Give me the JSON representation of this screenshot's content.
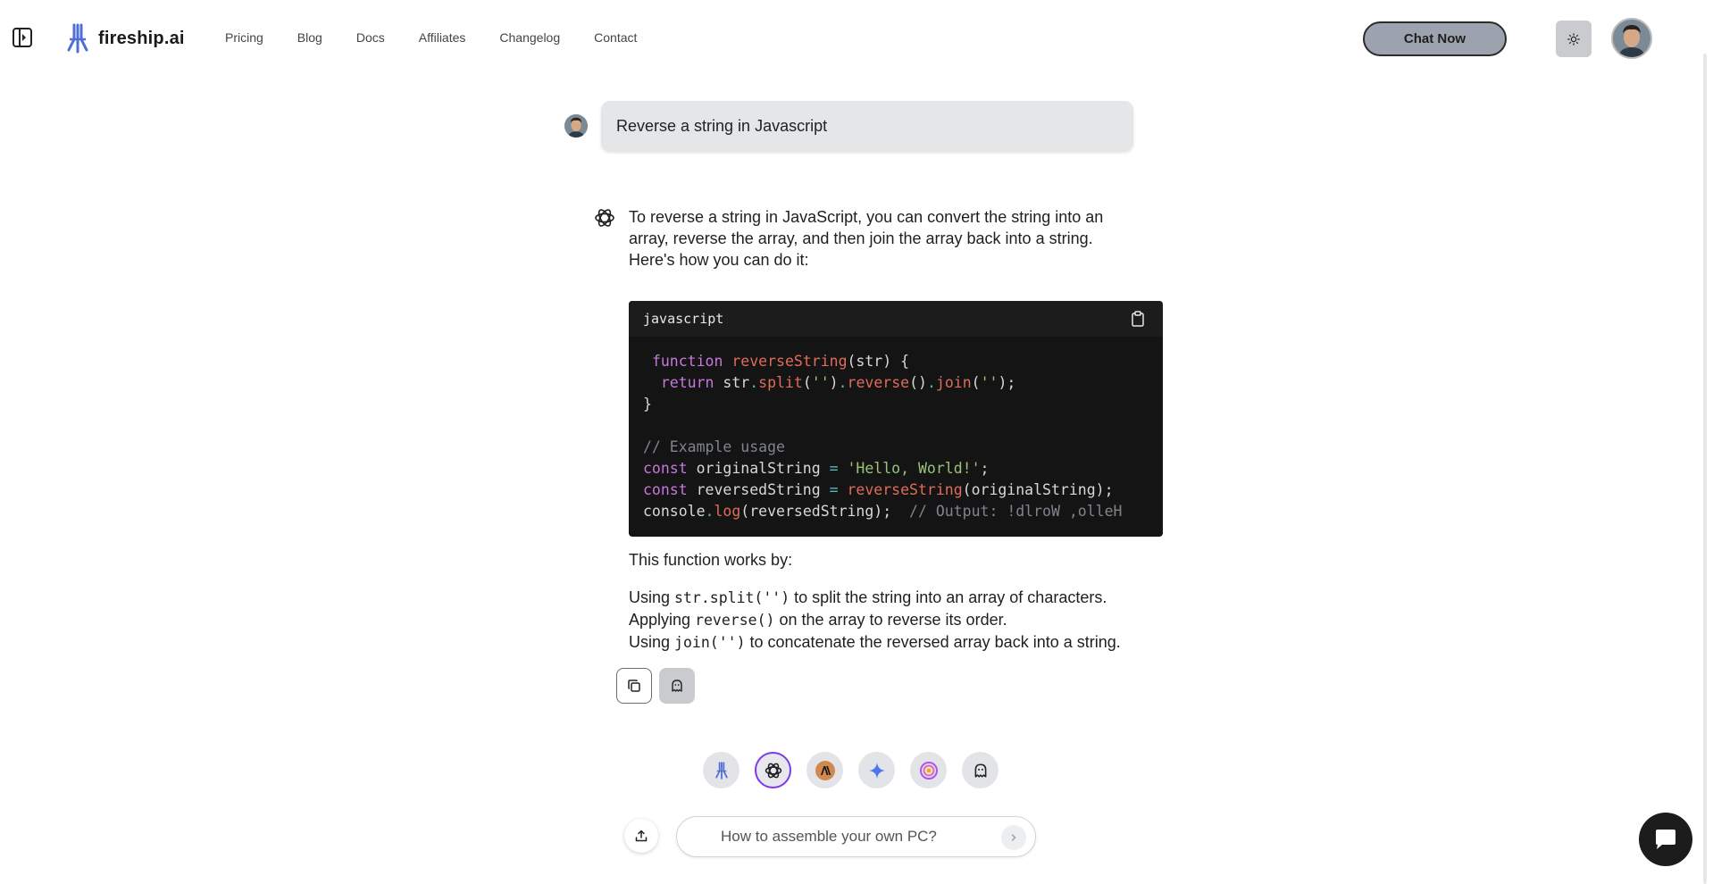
{
  "header": {
    "brand": "fireship.ai",
    "nav": [
      "Pricing",
      "Blog",
      "Docs",
      "Affiliates",
      "Changelog",
      "Contact"
    ],
    "chat_now_label": "Chat Now",
    "icons": {
      "sidebar": "sidebar-toggle-icon",
      "logo": "fireship-logo-icon",
      "theme": "sun-icon"
    }
  },
  "conversation": {
    "user_message": "Reverse a string in Javascript",
    "assistant_intro": "To reverse a string in JavaScript, you can convert the string into an array, reverse the array, and then join the array back into a string. Here's how you can do it:",
    "code": {
      "language": "javascript",
      "lines": [
        " function reverseString(str) {",
        "  return str.split('').reverse().join('');",
        "}",
        "",
        "// Example usage",
        "const originalString = 'Hello, World!';",
        "const reversedString = reverseString(originalString);",
        "console.log(reversedString);  // Output: !dlroW ,olleH"
      ]
    },
    "works_by": "This function works by:",
    "steps": [
      {
        "before": "Using ",
        "code": "str.split('')",
        "after": " to split the string into an array of characters."
      },
      {
        "before": "Applying ",
        "code": "reverse()",
        "after": " on the array to reverse its order."
      },
      {
        "before": "Using ",
        "code": "join('')",
        "after": " to concatenate the reversed array back into a string."
      }
    ]
  },
  "models": [
    "fireship",
    "openai",
    "anthropic",
    "gemini",
    "llama",
    "ghost"
  ],
  "active_model": "openai",
  "input": {
    "placeholder": "How to assemble your own PC?",
    "value": ""
  },
  "colors": {
    "accent": "#7c3aed",
    "code_bg": "#141414",
    "user_bubble": "#e5e6e8",
    "chat_now_bg": "#9ca3af"
  }
}
